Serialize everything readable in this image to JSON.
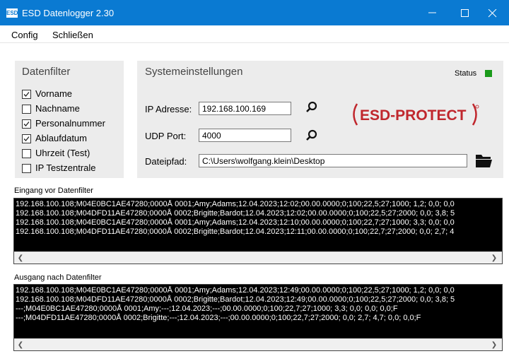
{
  "window": {
    "title": "ESD Datenlogger 2.30",
    "icon_text": "ESD"
  },
  "menu": {
    "config": "Config",
    "close": "Schließen"
  },
  "datenfilter": {
    "title": "Datenfilter",
    "items": [
      {
        "label": "Vorname",
        "checked": true
      },
      {
        "label": "Nachname",
        "checked": false
      },
      {
        "label": "Personalnummer",
        "checked": true
      },
      {
        "label": "Ablaufdatum",
        "checked": true
      },
      {
        "label": "Uhrzeit (Test)",
        "checked": false
      },
      {
        "label": "IP Testzentrale",
        "checked": false
      }
    ]
  },
  "system": {
    "title": "Systemeinstellungen",
    "status_label": "Status",
    "status_color": "#1a9a1a",
    "ip_label": "IP Adresse:",
    "ip_value": "192.168.100.169",
    "udp_label": "UDP Port:",
    "udp_value": "4000",
    "path_label": "Dateipfad:",
    "path_value": "C:\\Users\\wolfgang.klein\\Desktop",
    "icons": {
      "ip": "search-icon",
      "udp": "search-icon",
      "path": "folder-icon"
    }
  },
  "logo": {
    "text": "ESD-PROTECT",
    "color": "#c0272d"
  },
  "input_log": {
    "label": "Eingang vor Datenfilter",
    "lines": [
      "192.168.100.108;M04E0BC1AE47280;0000Å 0001;Amy;Adams;12.04.2023;12:02;00.00.0000;0;100;22,5;27;1000; 1,2; 0,0; 0,0",
      "192.168.100.108;M04DFD11AE47280;0000Å 0002;Brigitte;Bardot;12.04.2023;12:02;00.00.0000;0;100;22,5;27;2000; 0,0; 3,8; 5",
      "192.168.100.108;M04E0BC1AE47280;0000Å 0001;Amy;Adams;12.04.2023;12:10;00.00.0000;0;100;22,7;27;1000; 3,3; 0,0; 0,0",
      "192.168.100.108;M04DFD11AE47280;0000Å 0002;Brigitte;Bardot;12.04.2023;12:11;00.00.0000;0;100;22,7;27;2000; 0,0; 2,7; 4"
    ]
  },
  "output_log": {
    "label": "Ausgang nach Datenfilter",
    "lines": [
      "192.168.100.108;M04E0BC1AE47280;0000Å 0001;Amy;Adams;12.04.2023;12:49;00.00.0000;0;100;22,5;27;1000; 1,2; 0,0; 0,0",
      "192.168.100.108;M04DFD11AE47280;0000Å 0002;Brigitte;Bardot;12.04.2023;12:49;00.00.0000;0;100;22,5;27;2000; 0,0; 3,8; 5",
      "---;M04E0BC1AE47280;0000Å 0001;Amy;---;12.04.2023;---;00.00.0000;0;100;22,7;27;1000; 3,3; 0,0; 0,0; 0,0;F",
      "---;M04DFD11AE47280;0000Å 0002;Brigitte;---;12.04.2023;---;00.00.0000;0;100;22,7;27;2000; 0,0; 2,7; 4,7; 0,0; 0,0;F"
    ]
  }
}
